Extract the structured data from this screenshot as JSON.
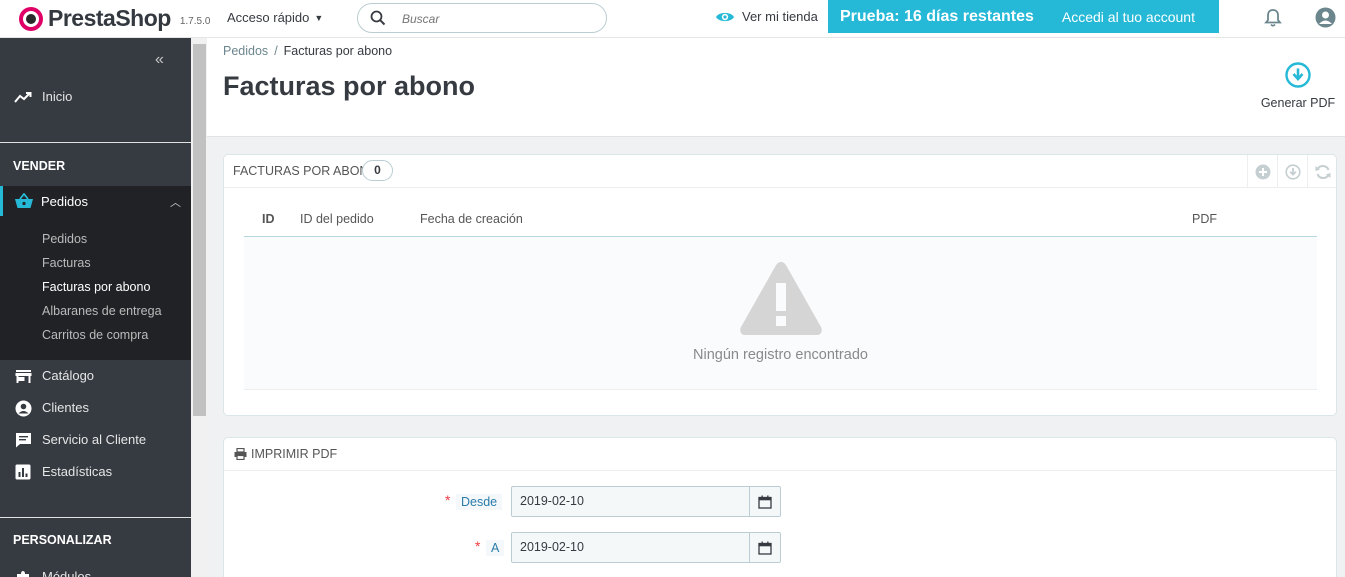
{
  "header": {
    "logo_text": "PrestaShop",
    "version": "1.7.5.0",
    "quick_access": "Acceso rápido",
    "search_placeholder": "Buscar",
    "view_store": "Ver mi tienda",
    "trial_text": "Prueba: 16 días restantes",
    "account_link": "Accedi al tuo account"
  },
  "sidebar": {
    "home": "Inicio",
    "section_sell": "VENDER",
    "orders_group": {
      "label": "Pedidos",
      "items": [
        "Pedidos",
        "Facturas",
        "Facturas por abono",
        "Albaranes de entrega",
        "Carritos de compra"
      ],
      "current_index": 2
    },
    "catalog": "Catálogo",
    "customers": "Clientes",
    "customer_service": "Servicio al Cliente",
    "stats": "Estadísticas",
    "section_customize": "PERSONALIZAR",
    "modules": "Módulos"
  },
  "page": {
    "breadcrumb": [
      "Pedidos",
      "Facturas por abono"
    ],
    "title": "Facturas por abono",
    "generate_pdf": "Generar PDF"
  },
  "list_panel": {
    "title": "FACTURAS POR ABONO",
    "count": "0",
    "columns": [
      "ID",
      "ID del pedido",
      "Fecha de creación",
      "PDF"
    ],
    "empty_message": "Ningún registro encontrado"
  },
  "print_panel": {
    "title": "IMPRIMIR PDF",
    "from_label": "Desde",
    "from_value": "2019-02-10",
    "to_label": "A",
    "to_value": "2019-02-10",
    "required_mark": "*"
  },
  "colors": {
    "accent": "#25b9d7",
    "sidebar_bg": "#363a41",
    "sidebar_active_bg": "#202226",
    "required": "#e93a40"
  }
}
